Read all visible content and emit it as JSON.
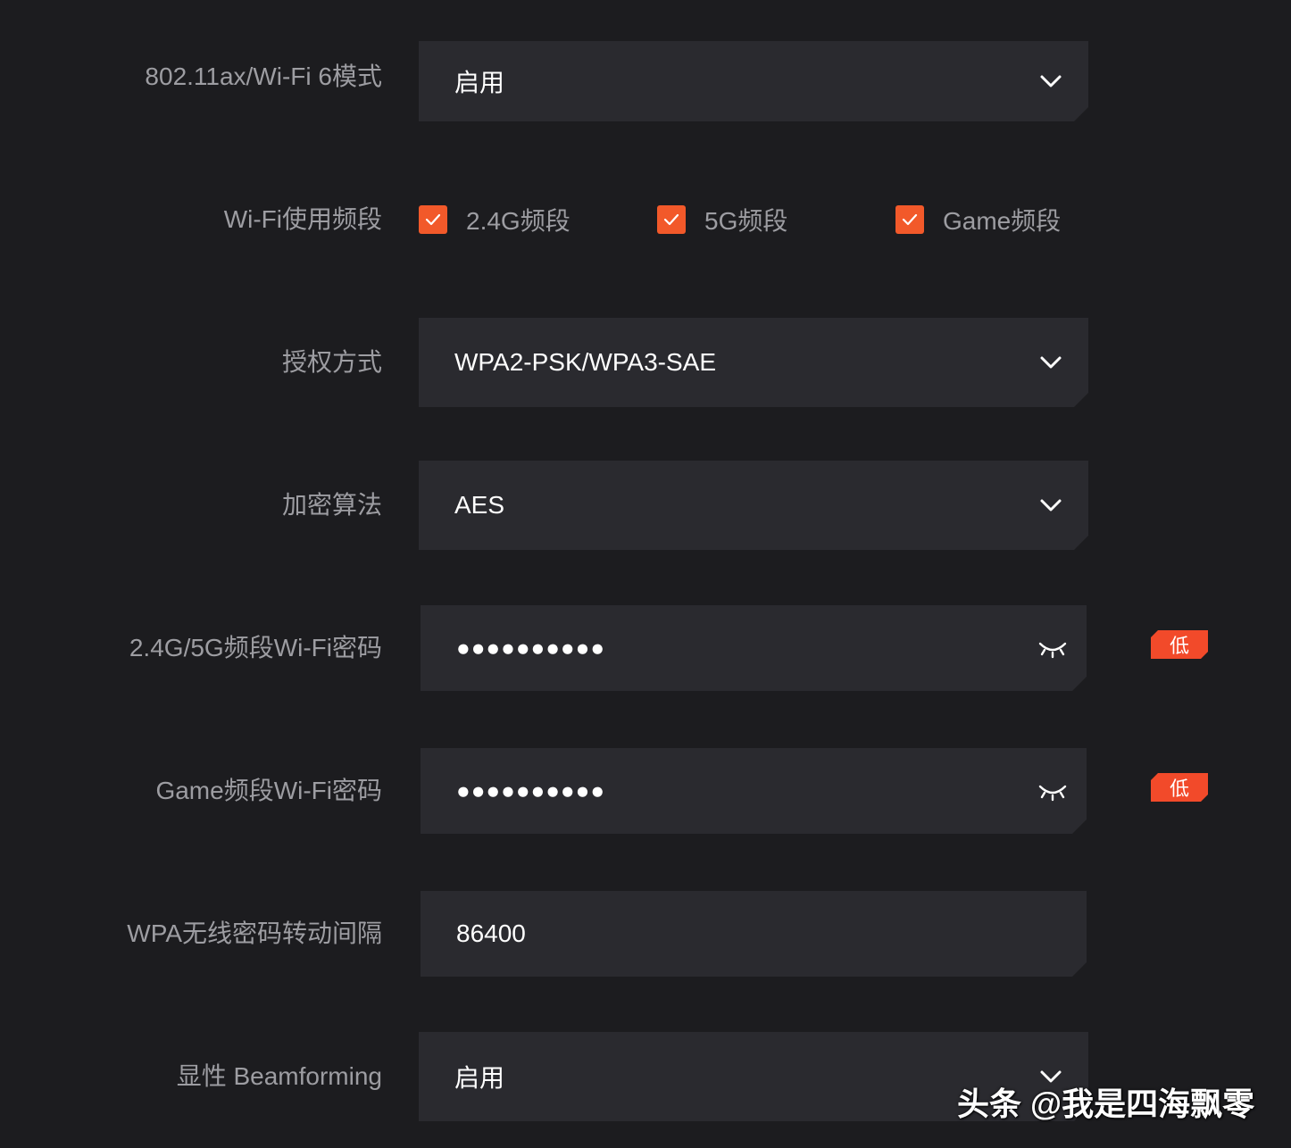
{
  "colors": {
    "background": "#1c1c1f",
    "field": "#2a2a2f",
    "accent": "#f2592a",
    "badge": "#f24a2a",
    "label": "#9d9da2"
  },
  "wifi6_mode": {
    "label": "802.11ax/Wi-Fi 6模式",
    "value": "启用",
    "icon": "chevron-down-icon"
  },
  "wifi_bands": {
    "label": "Wi-Fi使用频段",
    "options": [
      {
        "label": "2.4G频段",
        "checked": true
      },
      {
        "label": "5G频段",
        "checked": true
      },
      {
        "label": "Game频段",
        "checked": true
      }
    ]
  },
  "auth_mode": {
    "label": "授权方式",
    "value": "WPA2-PSK/WPA3-SAE",
    "icon": "chevron-down-icon"
  },
  "encryption": {
    "label": "加密算法",
    "value": "AES",
    "icon": "chevron-down-icon"
  },
  "password_main": {
    "label": "2.4G/5G频段Wi-Fi密码",
    "value": "●●●●●●●●●●",
    "icon": "eye-closed-icon",
    "strength": "低"
  },
  "password_game": {
    "label": "Game频段Wi-Fi密码",
    "value": "●●●●●●●●●●",
    "icon": "eye-closed-icon",
    "strength": "低"
  },
  "rekey_interval": {
    "label": "WPA无线密码转动间隔",
    "value": "86400"
  },
  "beamforming": {
    "label": "显性 Beamforming",
    "value": "启用",
    "icon": "chevron-down-icon"
  },
  "watermark": "头条 @我是四海飘零"
}
